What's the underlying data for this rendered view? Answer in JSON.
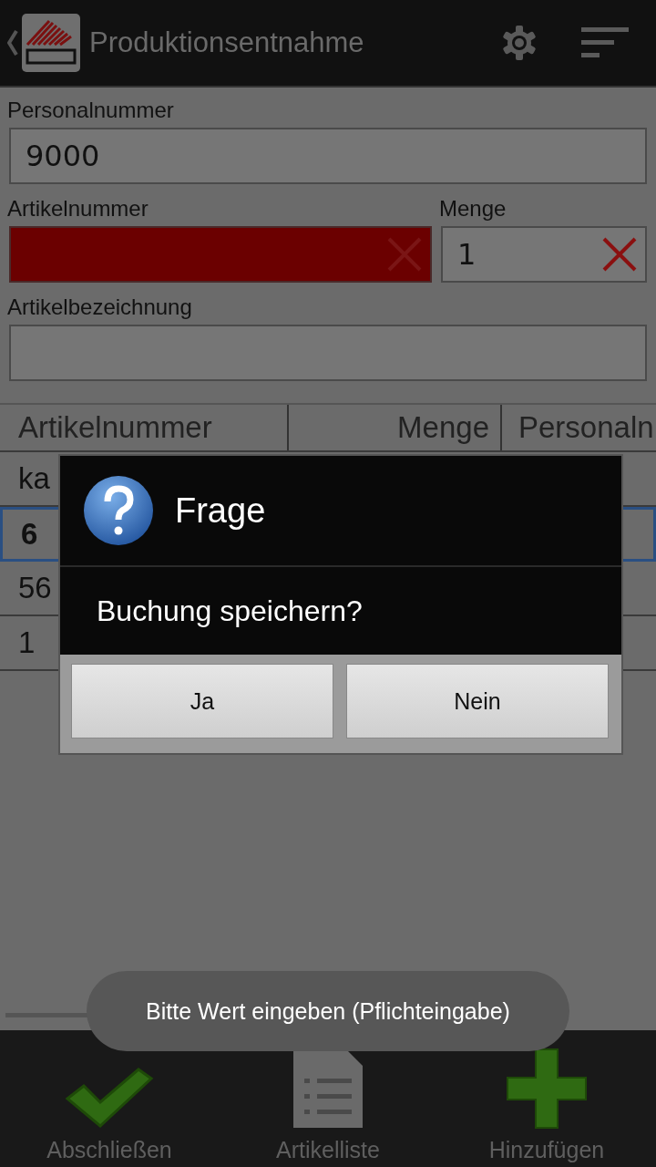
{
  "action_bar": {
    "title": "Produktionsentnahme"
  },
  "form": {
    "personalnummer": {
      "label": "Personalnummer",
      "value": "9000"
    },
    "artikelnummer": {
      "label": "Artikelnummer",
      "invalid": true
    },
    "menge": {
      "label": "Menge",
      "value": "1"
    },
    "artikelbezeichnung": {
      "label": "Artikelbezeichnung"
    }
  },
  "table": {
    "columns": [
      "Artikelnummer",
      "Menge",
      "Personaln"
    ],
    "rows": [
      {
        "cells": [
          "ka"
        ],
        "selected": false
      },
      {
        "cells": [
          "6"
        ],
        "selected": true
      },
      {
        "cells": [
          "56"
        ],
        "selected": false
      },
      {
        "cells": [
          "1"
        ],
        "selected": false
      }
    ]
  },
  "dialog": {
    "title": "Frage",
    "message": "Buchung speichern?",
    "buttons": [
      "Ja",
      "Nein"
    ]
  },
  "toast": "Bitte Wert eingeben (Pflichteingabe)",
  "bottom_bar": [
    {
      "label": "Abschließen",
      "kind": "check"
    },
    {
      "label": "Artikelliste",
      "kind": "list"
    },
    {
      "label": "Hinzufügen",
      "kind": "plus"
    }
  ]
}
